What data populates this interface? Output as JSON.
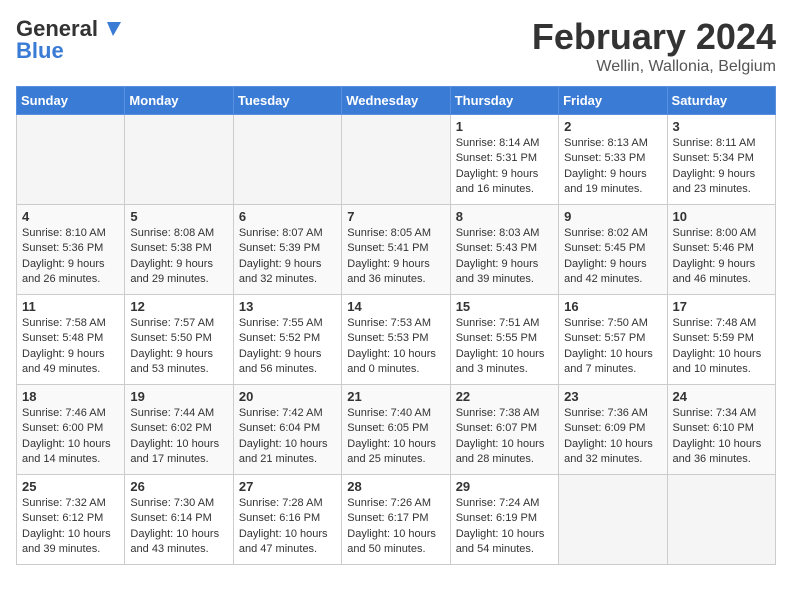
{
  "logo": {
    "general": "General",
    "blue": "Blue"
  },
  "header": {
    "month": "February 2024",
    "location": "Wellin, Wallonia, Belgium"
  },
  "days_of_week": [
    "Sunday",
    "Monday",
    "Tuesday",
    "Wednesday",
    "Thursday",
    "Friday",
    "Saturday"
  ],
  "weeks": [
    [
      {
        "day": "",
        "info": ""
      },
      {
        "day": "",
        "info": ""
      },
      {
        "day": "",
        "info": ""
      },
      {
        "day": "",
        "info": ""
      },
      {
        "day": "1",
        "info": "Sunrise: 8:14 AM\nSunset: 5:31 PM\nDaylight: 9 hours\nand 16 minutes."
      },
      {
        "day": "2",
        "info": "Sunrise: 8:13 AM\nSunset: 5:33 PM\nDaylight: 9 hours\nand 19 minutes."
      },
      {
        "day": "3",
        "info": "Sunrise: 8:11 AM\nSunset: 5:34 PM\nDaylight: 9 hours\nand 23 minutes."
      }
    ],
    [
      {
        "day": "4",
        "info": "Sunrise: 8:10 AM\nSunset: 5:36 PM\nDaylight: 9 hours\nand 26 minutes."
      },
      {
        "day": "5",
        "info": "Sunrise: 8:08 AM\nSunset: 5:38 PM\nDaylight: 9 hours\nand 29 minutes."
      },
      {
        "day": "6",
        "info": "Sunrise: 8:07 AM\nSunset: 5:39 PM\nDaylight: 9 hours\nand 32 minutes."
      },
      {
        "day": "7",
        "info": "Sunrise: 8:05 AM\nSunset: 5:41 PM\nDaylight: 9 hours\nand 36 minutes."
      },
      {
        "day": "8",
        "info": "Sunrise: 8:03 AM\nSunset: 5:43 PM\nDaylight: 9 hours\nand 39 minutes."
      },
      {
        "day": "9",
        "info": "Sunrise: 8:02 AM\nSunset: 5:45 PM\nDaylight: 9 hours\nand 42 minutes."
      },
      {
        "day": "10",
        "info": "Sunrise: 8:00 AM\nSunset: 5:46 PM\nDaylight: 9 hours\nand 46 minutes."
      }
    ],
    [
      {
        "day": "11",
        "info": "Sunrise: 7:58 AM\nSunset: 5:48 PM\nDaylight: 9 hours\nand 49 minutes."
      },
      {
        "day": "12",
        "info": "Sunrise: 7:57 AM\nSunset: 5:50 PM\nDaylight: 9 hours\nand 53 minutes."
      },
      {
        "day": "13",
        "info": "Sunrise: 7:55 AM\nSunset: 5:52 PM\nDaylight: 9 hours\nand 56 minutes."
      },
      {
        "day": "14",
        "info": "Sunrise: 7:53 AM\nSunset: 5:53 PM\nDaylight: 10 hours\nand 0 minutes."
      },
      {
        "day": "15",
        "info": "Sunrise: 7:51 AM\nSunset: 5:55 PM\nDaylight: 10 hours\nand 3 minutes."
      },
      {
        "day": "16",
        "info": "Sunrise: 7:50 AM\nSunset: 5:57 PM\nDaylight: 10 hours\nand 7 minutes."
      },
      {
        "day": "17",
        "info": "Sunrise: 7:48 AM\nSunset: 5:59 PM\nDaylight: 10 hours\nand 10 minutes."
      }
    ],
    [
      {
        "day": "18",
        "info": "Sunrise: 7:46 AM\nSunset: 6:00 PM\nDaylight: 10 hours\nand 14 minutes."
      },
      {
        "day": "19",
        "info": "Sunrise: 7:44 AM\nSunset: 6:02 PM\nDaylight: 10 hours\nand 17 minutes."
      },
      {
        "day": "20",
        "info": "Sunrise: 7:42 AM\nSunset: 6:04 PM\nDaylight: 10 hours\nand 21 minutes."
      },
      {
        "day": "21",
        "info": "Sunrise: 7:40 AM\nSunset: 6:05 PM\nDaylight: 10 hours\nand 25 minutes."
      },
      {
        "day": "22",
        "info": "Sunrise: 7:38 AM\nSunset: 6:07 PM\nDaylight: 10 hours\nand 28 minutes."
      },
      {
        "day": "23",
        "info": "Sunrise: 7:36 AM\nSunset: 6:09 PM\nDaylight: 10 hours\nand 32 minutes."
      },
      {
        "day": "24",
        "info": "Sunrise: 7:34 AM\nSunset: 6:10 PM\nDaylight: 10 hours\nand 36 minutes."
      }
    ],
    [
      {
        "day": "25",
        "info": "Sunrise: 7:32 AM\nSunset: 6:12 PM\nDaylight: 10 hours\nand 39 minutes."
      },
      {
        "day": "26",
        "info": "Sunrise: 7:30 AM\nSunset: 6:14 PM\nDaylight: 10 hours\nand 43 minutes."
      },
      {
        "day": "27",
        "info": "Sunrise: 7:28 AM\nSunset: 6:16 PM\nDaylight: 10 hours\nand 47 minutes."
      },
      {
        "day": "28",
        "info": "Sunrise: 7:26 AM\nSunset: 6:17 PM\nDaylight: 10 hours\nand 50 minutes."
      },
      {
        "day": "29",
        "info": "Sunrise: 7:24 AM\nSunset: 6:19 PM\nDaylight: 10 hours\nand 54 minutes."
      },
      {
        "day": "",
        "info": ""
      },
      {
        "day": "",
        "info": ""
      }
    ]
  ]
}
